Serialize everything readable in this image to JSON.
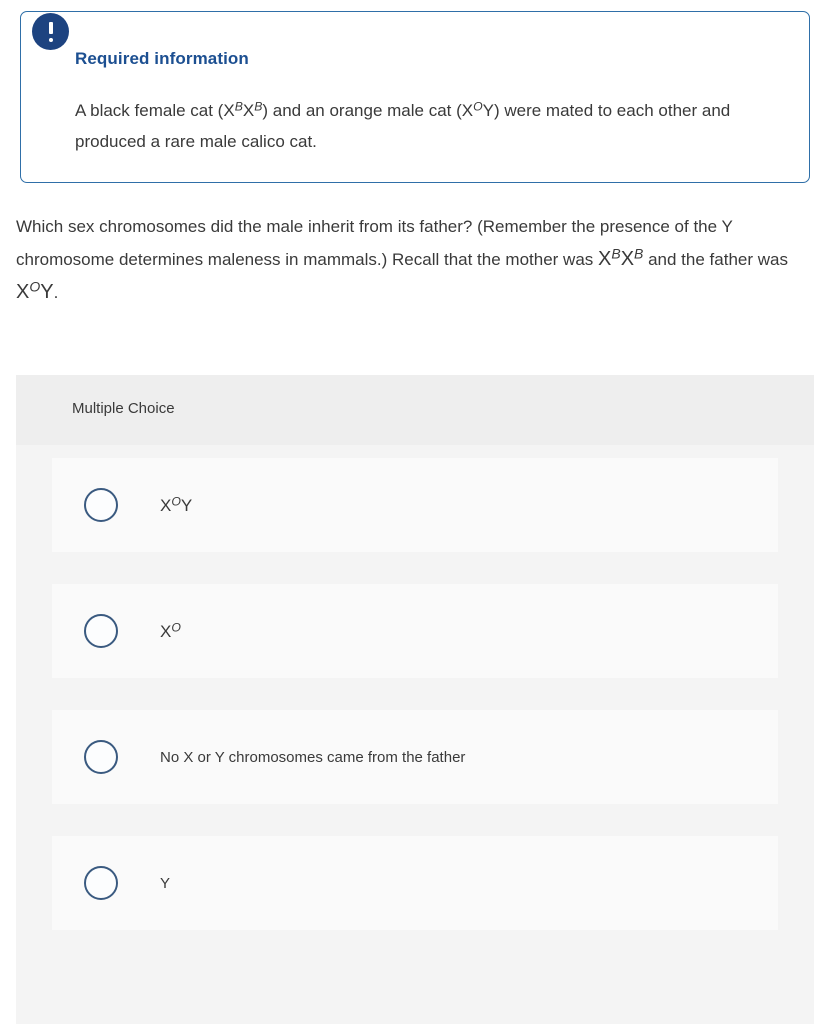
{
  "callout": {
    "icon": "exclamation-icon",
    "title": "Required information",
    "body_html": "A black female cat (X<sup>B</sup>X<sup>B</sup>) and an orange male cat (X<sup>O</sup>Y) were mated to each other and produced a rare male calico cat.",
    "border_color": "#2f6fa8",
    "title_color": "#1c4f91",
    "badge_color": "#1d4380"
  },
  "question": {
    "text_html": "Which sex chromosomes did the male inherit from its father? (Remember the presence of the Y chromosome determines maleness in mammals.) Recall that the mother was <span class=\"big\">X<sup>B</sup>X<sup>B</sup></span> and the father was <span class=\"big\">X<sup>O</sup>Y</span>."
  },
  "answer_panel": {
    "header_label": "Multiple Choice",
    "header_bg": "#eeeeee",
    "body_bg": "#f4f4f4",
    "option_bg": "#fafafa",
    "radio_border_color": "#3a5a80",
    "options": [
      {
        "id": "option-a",
        "label_html": "X<sup>O</sup>Y",
        "is_formula": true,
        "selected": false
      },
      {
        "id": "option-b",
        "label_html": "X<sup>O</sup>",
        "is_formula": true,
        "selected": false
      },
      {
        "id": "option-c",
        "label_html": "No X or Y chromosomes came from the father",
        "is_formula": false,
        "selected": false
      },
      {
        "id": "option-d",
        "label_html": "Y",
        "is_formula": false,
        "selected": false
      }
    ]
  }
}
